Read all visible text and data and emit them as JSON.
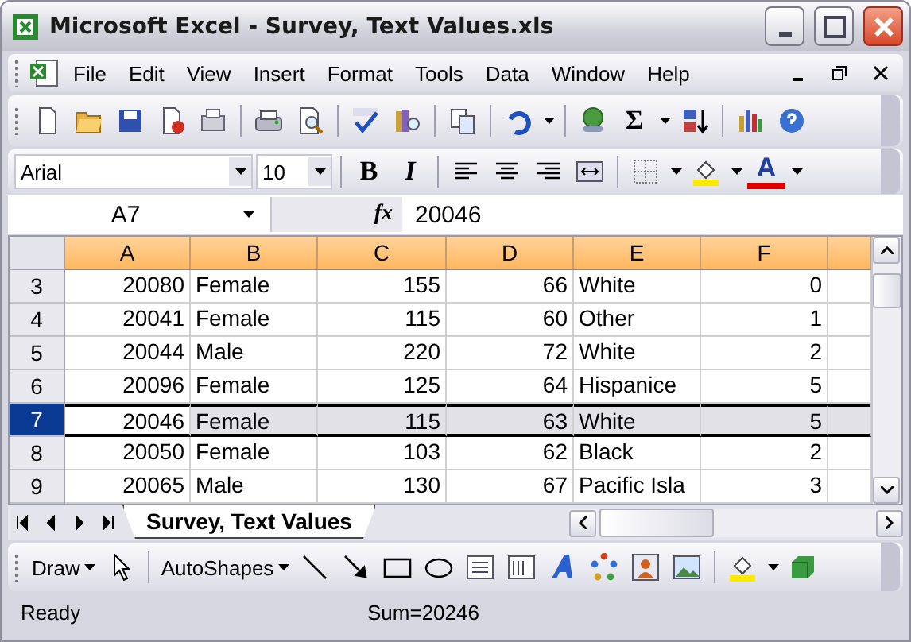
{
  "window": {
    "title": "Microsoft Excel - Survey, Text Values.xls"
  },
  "menu": [
    "File",
    "Edit",
    "View",
    "Insert",
    "Format",
    "Tools",
    "Data",
    "Window",
    "Help"
  ],
  "standard_bar": {
    "sum_glyph": "Σ"
  },
  "format_bar": {
    "font": "Arial",
    "size": "10",
    "bold": "B",
    "italic": "I",
    "font_color_glyph": "A"
  },
  "formula_bar": {
    "name_box": "A7",
    "fx": "fx",
    "value": "20046"
  },
  "sheet": {
    "columns": [
      {
        "label": "A",
        "kind": "number"
      },
      {
        "label": "B",
        "kind": "text"
      },
      {
        "label": "C",
        "kind": "number"
      },
      {
        "label": "D",
        "kind": "number"
      },
      {
        "label": "E",
        "kind": "text"
      },
      {
        "label": "F",
        "kind": "number"
      }
    ],
    "rows": [
      {
        "header": "3",
        "selected": false,
        "cells": [
          "20080",
          "Female",
          "155",
          "66",
          "White",
          "0"
        ]
      },
      {
        "header": "4",
        "selected": false,
        "cells": [
          "20041",
          "Female",
          "115",
          "60",
          "Other",
          "1"
        ]
      },
      {
        "header": "5",
        "selected": false,
        "cells": [
          "20044",
          "Male",
          "220",
          "72",
          "White",
          "2"
        ]
      },
      {
        "header": "6",
        "selected": false,
        "cells": [
          "20096",
          "Female",
          "125",
          "64",
          "Hispanice",
          "5"
        ]
      },
      {
        "header": "7",
        "selected": true,
        "cells": [
          "20046",
          "Female",
          "115",
          "63",
          "White",
          "5"
        ]
      },
      {
        "header": "8",
        "selected": false,
        "cells": [
          "20050",
          "Female",
          "103",
          "62",
          "Black",
          "2"
        ]
      },
      {
        "header": "9",
        "selected": false,
        "cells": [
          "20065",
          "Male",
          "130",
          "67",
          "Pacific Isla",
          "3"
        ]
      }
    ]
  },
  "sheet_tabs": [
    {
      "label": "Survey, Text Values",
      "selected": true
    }
  ],
  "draw_bar": {
    "draw": "Draw",
    "autoshapes": "AutoShapes"
  },
  "status_bar": {
    "message": "Ready",
    "sum": "Sum=20246"
  }
}
